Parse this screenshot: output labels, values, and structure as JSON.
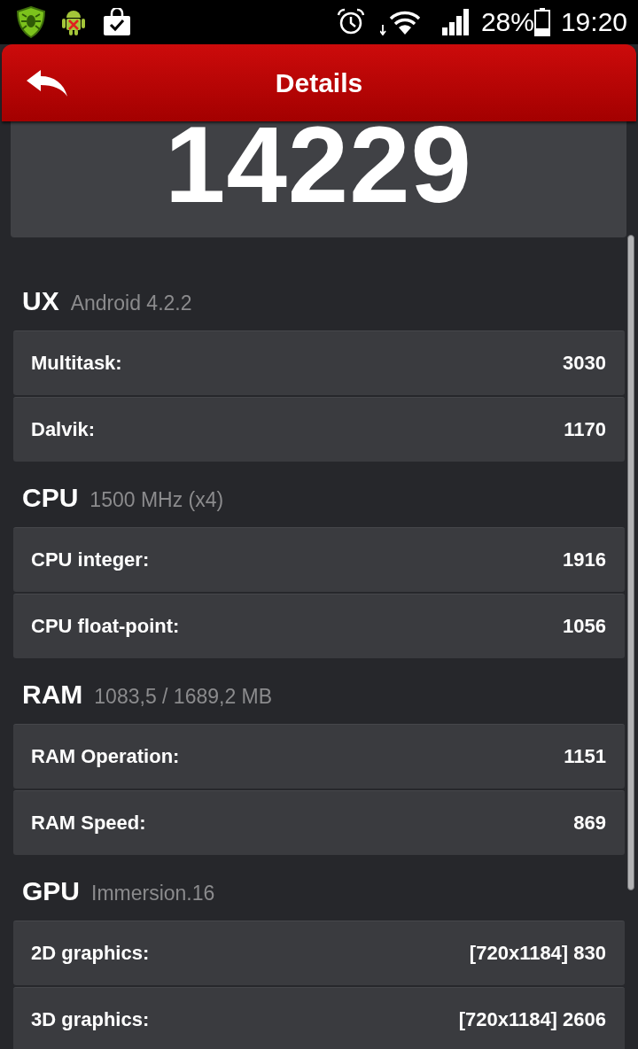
{
  "status_bar": {
    "battery": "28%",
    "time": "19:20"
  },
  "header": {
    "title": "Details"
  },
  "total_score": "14229",
  "sections": [
    {
      "name": "UX",
      "detail": "Android 4.2.2",
      "rows": [
        {
          "label": "Multitask:",
          "value": "3030"
        },
        {
          "label": "Dalvik:",
          "value": "1170"
        }
      ]
    },
    {
      "name": "CPU",
      "detail": "1500 MHz (x4)",
      "rows": [
        {
          "label": "CPU integer:",
          "value": "1916"
        },
        {
          "label": "CPU float-point:",
          "value": "1056"
        }
      ]
    },
    {
      "name": "RAM",
      "detail": "1083,5 / 1689,2 MB",
      "rows": [
        {
          "label": "RAM Operation:",
          "value": "1151"
        },
        {
          "label": "RAM Speed:",
          "value": "869"
        }
      ]
    },
    {
      "name": "GPU",
      "detail": "Immersion.16",
      "rows": [
        {
          "label": "2D graphics:",
          "value": "[720x1184] 830"
        },
        {
          "label": "3D graphics:",
          "value": "[720x1184] 2606"
        }
      ]
    }
  ]
}
